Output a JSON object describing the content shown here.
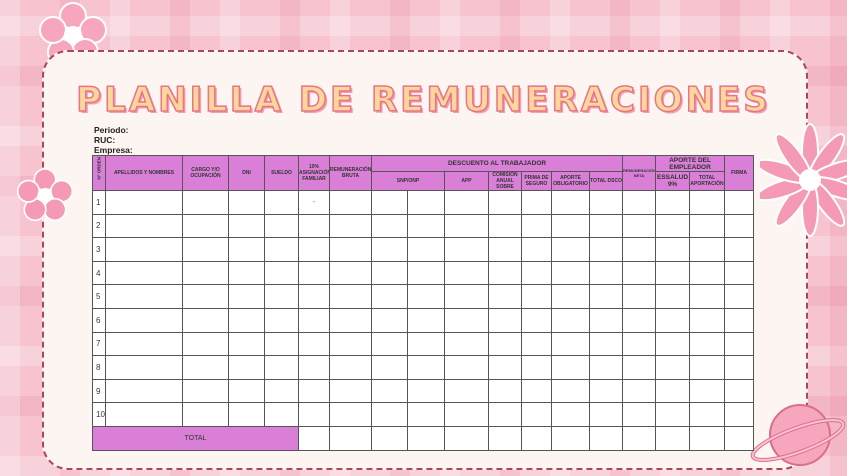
{
  "title": "PLANILLA DE REMUNERACIONES",
  "meta": {
    "periodo": "Periodo:",
    "ruc": "RUC:",
    "empresa": "Empresa:"
  },
  "headers": {
    "orden": "N° ORDEN",
    "apellidos": "APELLIDOS Y NOMBRES",
    "cargo": "CARGO Y/O OCUPACIÓN",
    "dni": "DNI",
    "sueldo": "SUELDO",
    "asignacion": "10% ASIGNACIÓN FAMILIAR",
    "bruta": "REMUNERACIÓN BRUTA",
    "descuento": "DESCUENTO AL TRABAJADOR",
    "snp": "SNP/ONP",
    "app": "APP",
    "comision": "COMISION ANUAL SOBRE",
    "prima": "PRIMA DE SEGURO",
    "aporte_oblig": "APORTE OBLIGATORIO",
    "total_desc": "TOTAL DSCO",
    "neta": "REMUNERACIÓN NETA",
    "aporte_empleador": "APORTE DEL EMPLEADOR",
    "essalud": "ESSALUD 9%",
    "total_aport": "TOTAL APORTACIÓN",
    "firma": "FIRMA"
  },
  "rows": [
    {
      "n": "1",
      "asig": "-"
    },
    {
      "n": "2"
    },
    {
      "n": "3"
    },
    {
      "n": "4"
    },
    {
      "n": "5"
    },
    {
      "n": "6"
    },
    {
      "n": "7"
    },
    {
      "n": "8"
    },
    {
      "n": "9"
    },
    {
      "n": "10"
    }
  ],
  "total_label": "TOTAL"
}
